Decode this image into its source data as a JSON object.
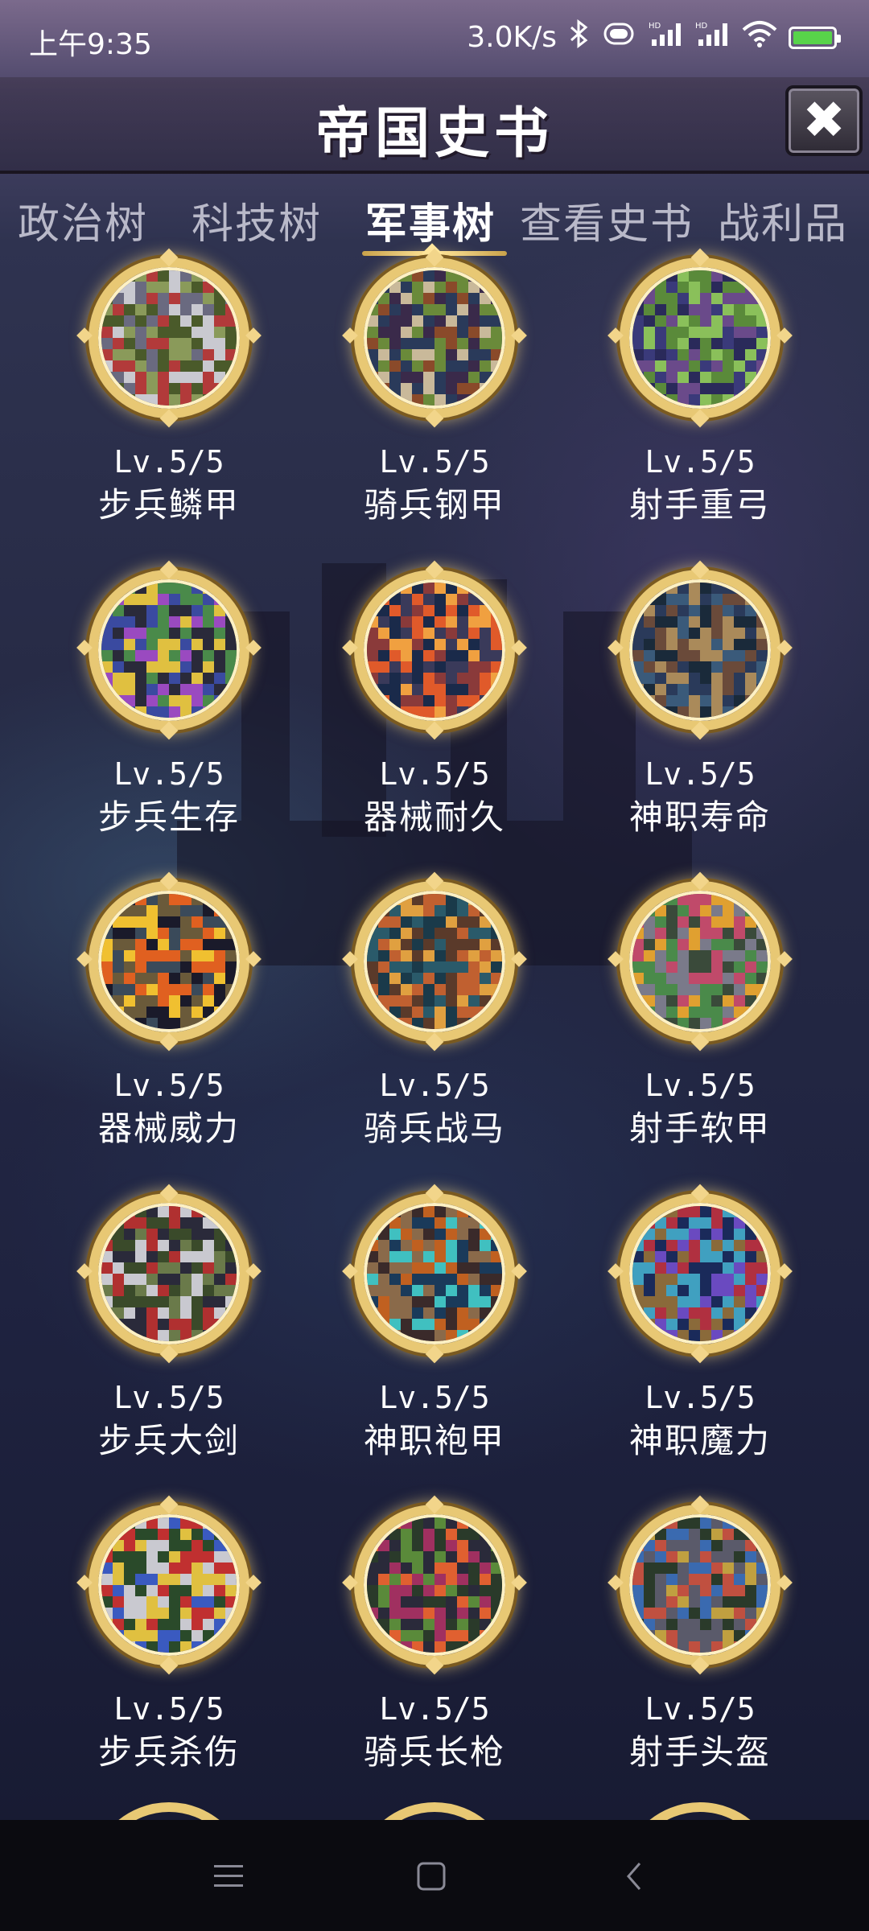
{
  "status_bar": {
    "time": "上午9:35",
    "net_speed": "3.0K/s",
    "icons": [
      "bluetooth-icon",
      "vibrate-icon",
      "signal-hd-icon",
      "signal-hd-icon",
      "wifi-icon",
      "battery-charging-icon"
    ],
    "battery_color": "#58d34a"
  },
  "header": {
    "title": "帝国史书",
    "close_label": "✖"
  },
  "tabs": [
    {
      "label": "政治树",
      "active": false
    },
    {
      "label": "科技树",
      "active": false
    },
    {
      "label": "军事树",
      "active": true
    },
    {
      "label": "查看史书",
      "active": false
    },
    {
      "label": "战利品",
      "active": false
    }
  ],
  "items": [
    {
      "level": "Lv.5/5",
      "name": "步兵鳞甲",
      "art": "infantry-knights"
    },
    {
      "level": "Lv.5/5",
      "name": "骑兵钢甲",
      "art": "cavalry-rider"
    },
    {
      "level": "Lv.5/5",
      "name": "射手重弓",
      "art": "archers"
    },
    {
      "level": "Lv.5/5",
      "name": "步兵生存",
      "art": "infantry-knight"
    },
    {
      "level": "Lv.5/5",
      "name": "器械耐久",
      "art": "burning-church"
    },
    {
      "level": "Lv.5/5",
      "name": "神职寿命",
      "art": "cathedral-interior"
    },
    {
      "level": "Lv.5/5",
      "name": "器械威力",
      "art": "forge-fire"
    },
    {
      "level": "Lv.5/5",
      "name": "骑兵战马",
      "art": "warhorse"
    },
    {
      "level": "Lv.5/5",
      "name": "射手软甲",
      "art": "ruins-archer"
    },
    {
      "level": "Lv.5/5",
      "name": "步兵大剑",
      "art": "greatsword-knight"
    },
    {
      "level": "Lv.5/5",
      "name": "神职袍甲",
      "art": "monk"
    },
    {
      "level": "Lv.5/5",
      "name": "神职魔力",
      "art": "church-priests"
    },
    {
      "level": "Lv.5/5",
      "name": "步兵杀伤",
      "art": "infantry-shield"
    },
    {
      "level": "Lv.5/5",
      "name": "骑兵长枪",
      "art": "lancer"
    },
    {
      "level": "Lv.5/5",
      "name": "射手头盔",
      "art": "helmet-archer"
    }
  ],
  "colors": {
    "medal_gold": "#e8c874",
    "tab_active": "#ffffff",
    "tab_inactive": "#b9b9c9"
  }
}
